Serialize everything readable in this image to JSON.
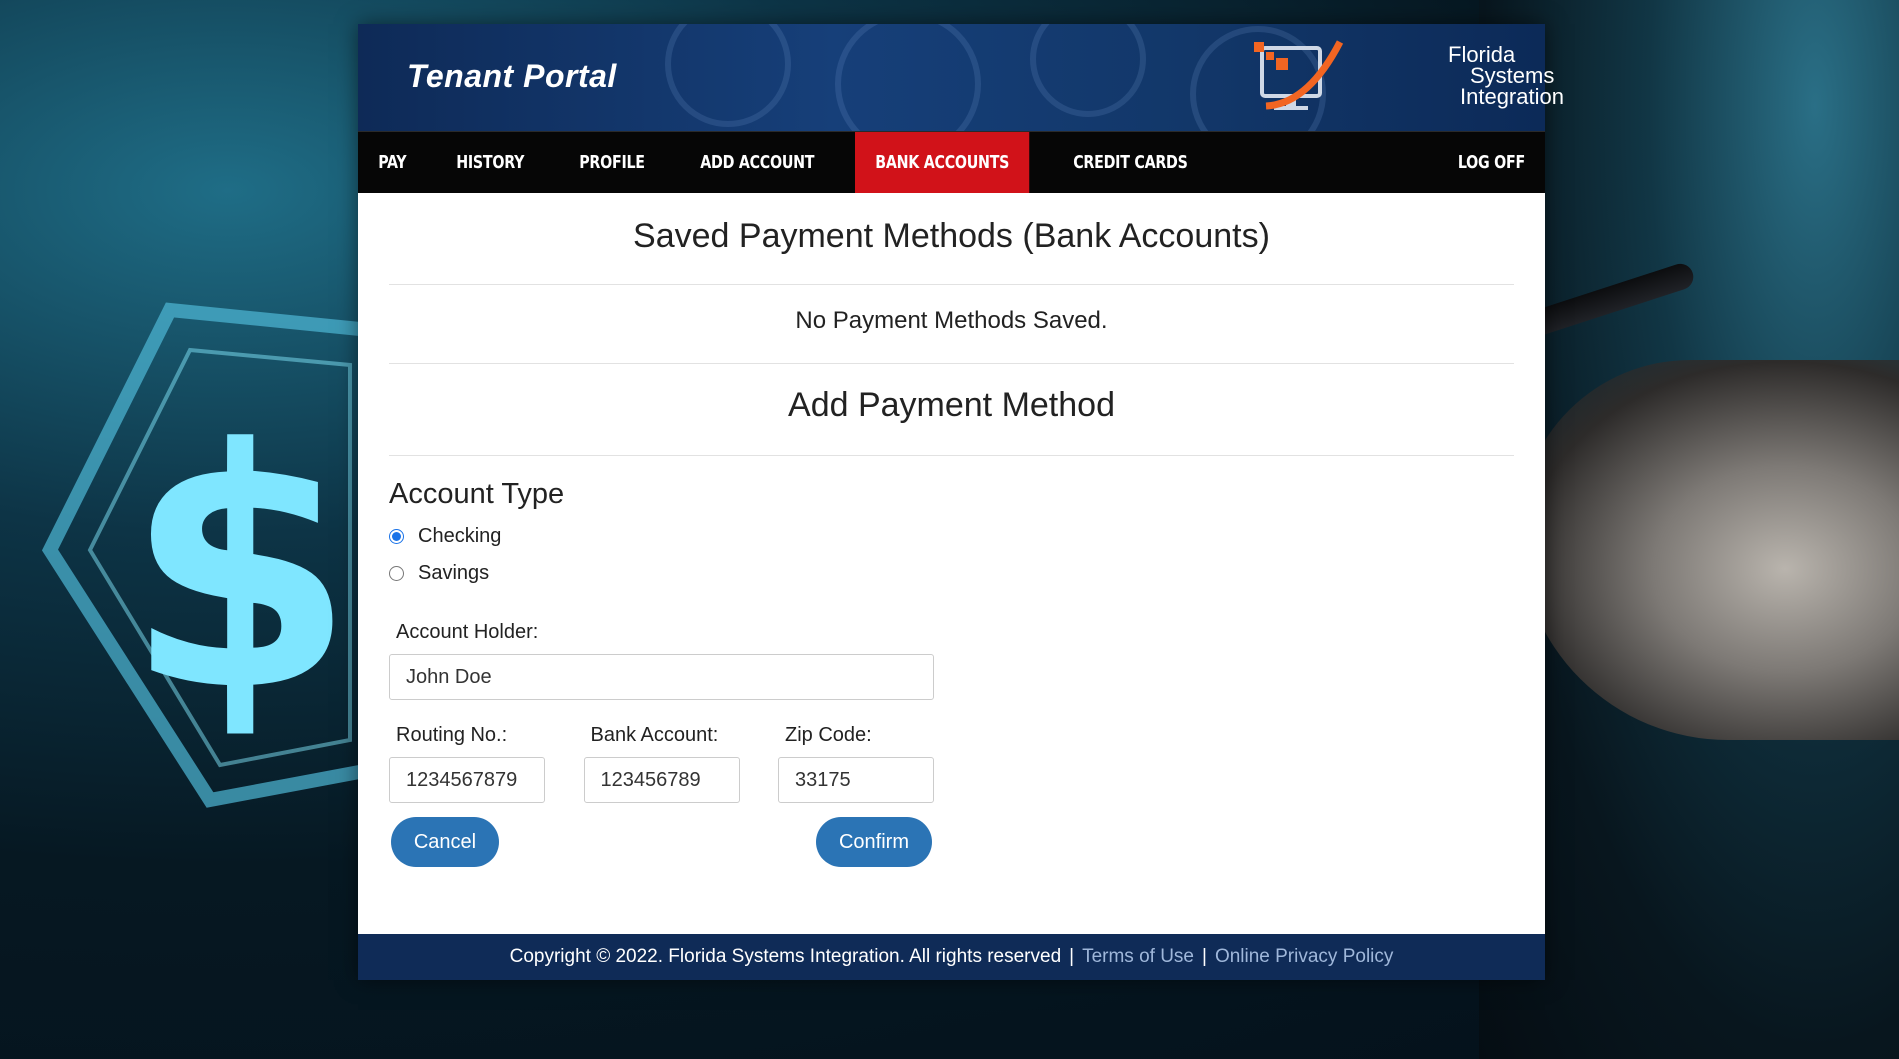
{
  "header": {
    "portal_title": "Tenant Portal",
    "logo_lines": [
      "Florida",
      "Systems",
      "Integration"
    ]
  },
  "nav": {
    "items": [
      {
        "label": "PAY",
        "active": false
      },
      {
        "label": "HISTORY",
        "active": false
      },
      {
        "label": "PROFILE",
        "active": false
      },
      {
        "label": "ADD ACCOUNT",
        "active": false
      },
      {
        "label": "BANK ACCOUNTS",
        "active": true
      },
      {
        "label": "CREDIT CARDS",
        "active": false
      }
    ],
    "logoff": "LOG OFF"
  },
  "saved": {
    "title": "Saved Payment Methods (Bank Accounts)",
    "empty_message": "No Payment Methods Saved."
  },
  "add": {
    "title": "Add Payment Method",
    "account_type_label": "Account Type",
    "options": [
      {
        "label": "Checking",
        "checked": true
      },
      {
        "label": "Savings",
        "checked": false
      }
    ],
    "account_holder_label": "Account Holder:",
    "account_holder_value": "John Doe",
    "routing_label": "Routing No.:",
    "routing_value": "1234567879",
    "bank_account_label": "Bank Account:",
    "bank_account_value": "123456789",
    "zip_label": "Zip Code:",
    "zip_value": "33175",
    "cancel_label": "Cancel",
    "confirm_label": "Confirm"
  },
  "footer": {
    "copyright": "Copyright © 2022. Florida Systems Integration. All rights reserved",
    "separator": "|",
    "terms": "Terms of Use",
    "privacy": "Online Privacy Policy"
  },
  "colors": {
    "header_bg": "#163f79",
    "nav_bg": "#060606",
    "nav_active": "#d11219",
    "button": "#2b74b5",
    "footer_bg": "#0f2b57",
    "footer_link": "#9fb7da"
  },
  "icons": [
    "dollar-hexagon-icon",
    "fsi-logo-icon",
    "radio-icon"
  ]
}
